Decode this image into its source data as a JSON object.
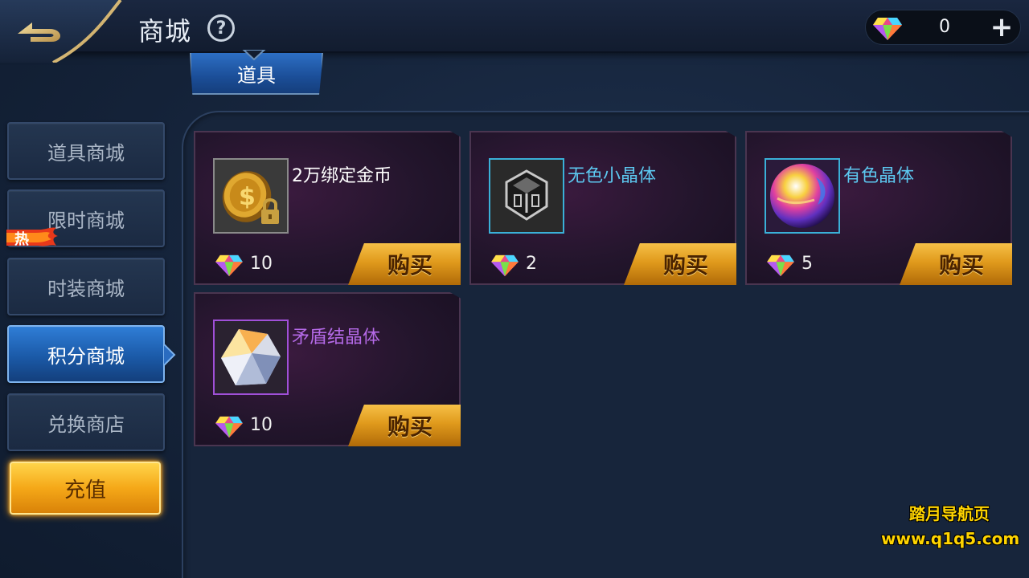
{
  "header": {
    "title": "商城",
    "help_label": "?",
    "currency": {
      "amount": "0",
      "icon": "gem-icon"
    },
    "plus_label": "+"
  },
  "tab": {
    "label": "道具"
  },
  "sidebar": {
    "items": [
      {
        "label": "道具商城",
        "active": false
      },
      {
        "label": "限时商城",
        "active": false,
        "badge": "热"
      },
      {
        "label": "时装商城",
        "active": false
      },
      {
        "label": "积分商城",
        "active": true
      },
      {
        "label": "兑换商店",
        "active": false
      }
    ],
    "recharge_label": "充值"
  },
  "items": [
    {
      "name": "2万绑定金币",
      "price": "10",
      "buy_label": "购买",
      "name_color": "#ffffff",
      "icon": "gold-coin-icon"
    },
    {
      "name": "无色小晶体",
      "price": "2",
      "buy_label": "购买",
      "name_color": "#5cc8f0",
      "icon": "colorless-crystal-icon"
    },
    {
      "name": "有色晶体",
      "price": "5",
      "buy_label": "购买",
      "name_color": "#5cc8f0",
      "icon": "colored-crystal-orb-icon"
    },
    {
      "name": "矛盾结晶体",
      "price": "10",
      "buy_label": "购买",
      "name_color": "#b56ae8",
      "icon": "contradiction-crystal-icon"
    }
  ],
  "watermark": {
    "line1": "踏月导航页",
    "line2": "www.q1q5.com"
  },
  "colors": {
    "accent_blue": "#2f7dd6",
    "gold": "#f5a818",
    "blue_name": "#5cc8f0",
    "purple_name": "#b56ae8"
  }
}
